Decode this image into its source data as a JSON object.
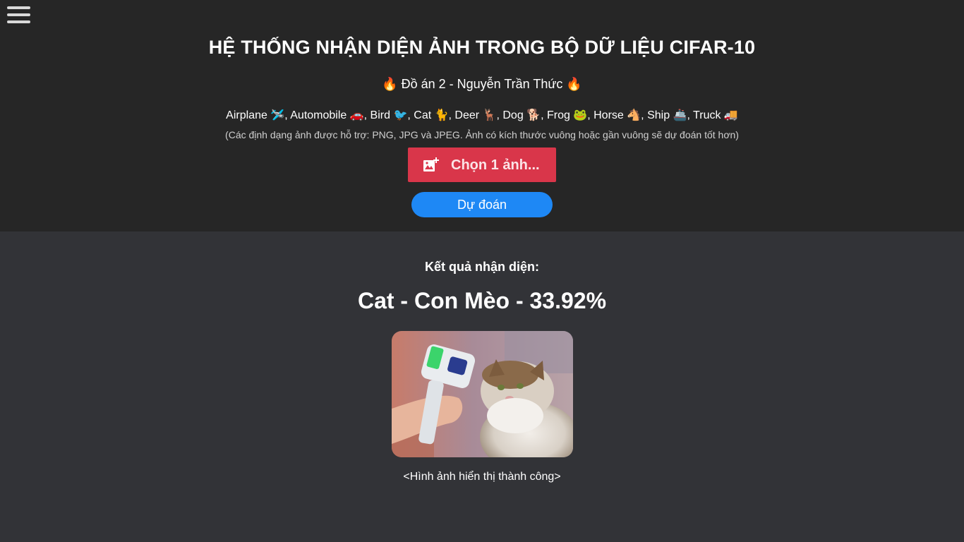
{
  "header": {
    "title": "HỆ THỐNG NHẬN DIỆN ẢNH TRONG BỘ DỮ LIỆU CIFAR-10",
    "subtitle": "🔥 Đồ án 2 - Nguyễn Trần Thức 🔥",
    "classes": "Airplane 🛩️, Automobile 🚗, Bird 🐦, Cat 🐈, Deer 🦌, Dog 🐕, Frog 🐸, Horse 🐴, Ship 🚢, Truck 🚚",
    "note": "(Các định dạng ảnh được hỗ trợ: PNG, JPG và JPEG. Ảnh có kích thước vuông hoặc gần vuông sẽ dự đoán tốt hơn)",
    "choose_label": "Chọn 1 ảnh...",
    "choose_icon": "add-photo-icon",
    "predict_label": "Dự đoán"
  },
  "result": {
    "heading": "Kết quả nhận diện:",
    "value": "Cat - Con Mèo - 33.92%",
    "caption": "<Hình ảnh hiển thị thành công>"
  },
  "colors": {
    "header_bg": "#262626",
    "body_bg": "#323337",
    "choose_button": "#d9364a",
    "predict_button": "#1e88f5"
  }
}
